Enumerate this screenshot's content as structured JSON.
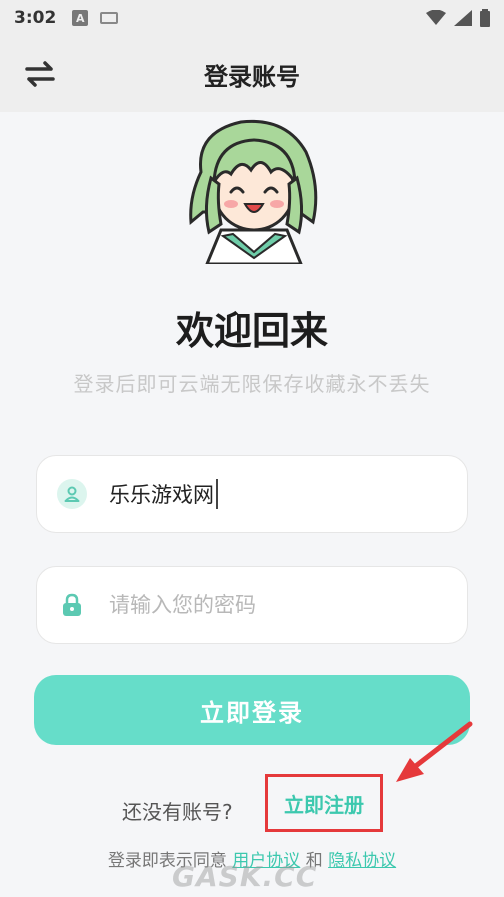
{
  "status_bar": {
    "time": "3:02",
    "a_badge": "A"
  },
  "header": {
    "title": "登录账号",
    "swap_icon": "swap-arrows-icon"
  },
  "main": {
    "welcome_title": "欢迎回来",
    "subtitle": "登录后即可云端无限保存收藏永不丢失"
  },
  "form": {
    "username_value": "乐乐游戏网",
    "username_icon": "user-icon",
    "password_placeholder": "请输入您的密码",
    "password_icon": "lock-icon",
    "login_label": "立即登录"
  },
  "register": {
    "prompt": "还没有账号?",
    "link_label": "立即注册"
  },
  "agreement": {
    "prefix": "登录即表示同意",
    "user_agreement": "用户协议",
    "and": "和",
    "privacy_agreement": "隐私协议"
  },
  "watermark": "GASK.CC",
  "colors": {
    "accent": "#66ddc9",
    "link": "#3cc8ae",
    "highlight": "#e5393b"
  }
}
